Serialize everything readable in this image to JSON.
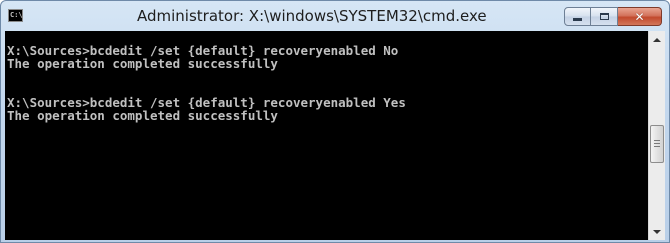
{
  "window": {
    "title": "Administrator: X:\\windows\\SYSTEM32\\cmd.exe",
    "icon": "cmd-icon",
    "icon_label": "C:\\"
  },
  "controls": {
    "minimize": "minimize-icon",
    "maximize": "maximize-icon",
    "close": "close-icon",
    "close_glyph": "✕"
  },
  "console": {
    "lines": [
      "X:\\Sources>bcdedit /set {default} recoveryenabled No",
      "The operation completed successfully",
      "",
      "X:\\Sources>bcdedit /set {default} recoveryenabled Yes",
      "The operation completed successfully"
    ]
  },
  "colors": {
    "console_background": "#000000",
    "console_text": "#c0c0c0",
    "close_button": "#c24a2d"
  }
}
